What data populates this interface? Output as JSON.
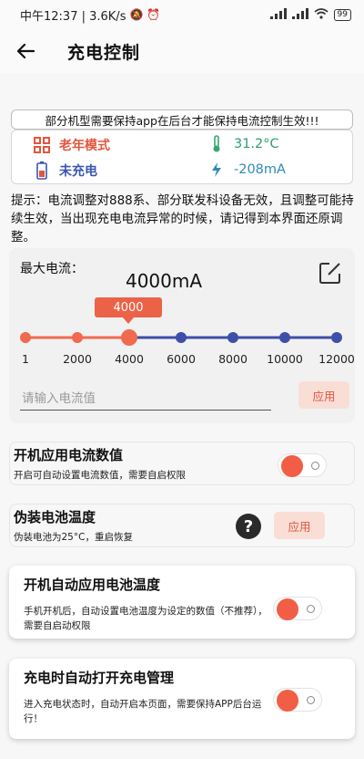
{
  "status_bar": {
    "text": "中午12:37 | 3.6K/s",
    "battery": "99"
  },
  "app_bar": {
    "title": "充电控制"
  },
  "notice": "部分机型需要保持app在后台才能保持电流控制生效!!!",
  "info": {
    "mode_label": "老年模式",
    "temperature": "31.2°C",
    "charge_state": "未充电",
    "current": "-208mA"
  },
  "tip": "提示：电流调整对888系、部分联发科设备无效，且调整可能持续生效，当出现充电电流异常的时候，请记得到本界面还原调整。",
  "max_current": {
    "label": "最大电流：",
    "value_text": "4000mA",
    "tooltip": "4000",
    "slider_value": 4000,
    "ticks": [
      "1",
      "2000",
      "4000",
      "6000",
      "8000",
      "10000",
      "12000"
    ],
    "input_placeholder": "请输入电流值",
    "apply_label": "应用",
    "active_color": "#ef6a4f",
    "inactive_color": "#3d4fa8"
  },
  "settings": [
    {
      "title": "开机应用电流数值",
      "desc": "开启可自动设置电流数值，需要自启权限",
      "enabled": true
    },
    {
      "title": "伪装电池温度",
      "desc": "伪装电池为25°C，重启恢复",
      "help": "?",
      "apply_label": "应用"
    },
    {
      "title": "开机自动应用电池温度",
      "desc": "手机开机后，自动设置电池温度为设定的数值（不推荐），需要自启动权限",
      "enabled": true
    },
    {
      "title": "充电时自动打开充电管理",
      "desc": "进入充电状态时，自动开启本页面，需要保持APP后台运行！",
      "enabled": true
    }
  ]
}
